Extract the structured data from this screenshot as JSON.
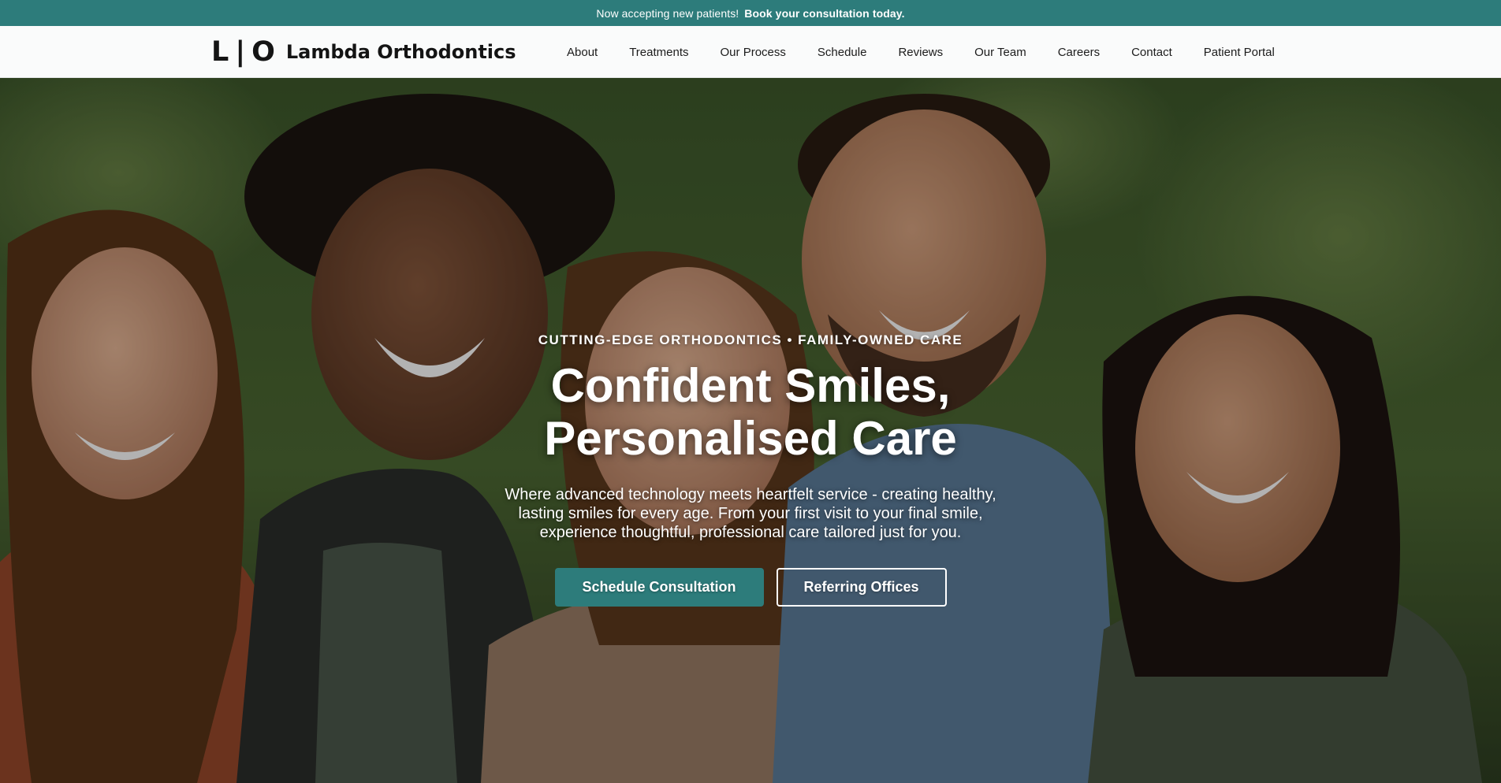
{
  "announcement": {
    "text": "Now accepting new patients!",
    "emphasis": "Book your consultation today.",
    "background": "#2d7c7b"
  },
  "brand": {
    "mark_left": "L",
    "mark_divider": "|",
    "mark_right": "O",
    "name": "Lambda Orthodontics"
  },
  "nav": {
    "items": [
      {
        "label": "About"
      },
      {
        "label": "Treatments"
      },
      {
        "label": "Our Process"
      },
      {
        "label": "Schedule"
      },
      {
        "label": "Reviews"
      },
      {
        "label": "Our Team"
      },
      {
        "label": "Careers"
      },
      {
        "label": "Contact"
      },
      {
        "label": "Patient Portal"
      }
    ]
  },
  "hero": {
    "eyebrow": "CUTTING-EDGE ORTHODONTICS • FAMILY-OWNED CARE",
    "title_line1": "Confident Smiles,",
    "title_line2": "Personalised Care",
    "subtitle": "Where advanced technology meets heartfelt service - creating healthy, lasting smiles for every age. From your first visit to your final smile, experience thoughtful, professional care tailored just for you.",
    "primary_cta": "Schedule Consultation",
    "secondary_cta": "Referring Offices",
    "background_image": "group-of-five-smiling-people-photo"
  },
  "colors": {
    "accent": "#2d7c7b",
    "nav_background": "#fafbfb",
    "text_dark": "#141414"
  }
}
